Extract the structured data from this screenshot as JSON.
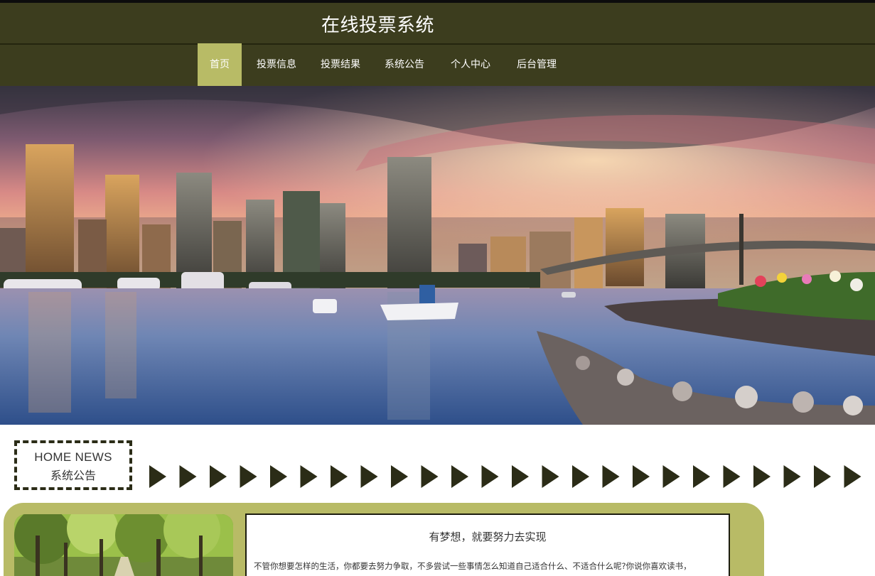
{
  "header": {
    "site_title": "在线投票系统"
  },
  "nav": {
    "items": [
      {
        "label": "首页",
        "active": true
      },
      {
        "label": "投票信息",
        "active": false
      },
      {
        "label": "投票结果",
        "active": false
      },
      {
        "label": "系统公告",
        "active": false
      },
      {
        "label": "个人中心",
        "active": false
      },
      {
        "label": "后台管理",
        "active": false
      }
    ]
  },
  "banner": {
    "image": "city-skyline-harbor-sunset",
    "slide_count": 3,
    "active_slide": 3
  },
  "news_section": {
    "title_en": "HOME NEWS",
    "title_cn": "系统公告",
    "arrow_icon": "triangle-right-icon"
  },
  "news_item": {
    "image": "tree-lined-avenue",
    "headline": "有梦想，就要努力去实现",
    "excerpt": "不管你想要怎样的生活，你都要去努力争取，不多尝试一些事情怎么知道自己适合什么、不适合什么呢?你说你喜欢读书，"
  },
  "colors": {
    "header_bg": "#3c3d1e",
    "accent": "#b8bb66",
    "text_dark": "#333333"
  }
}
